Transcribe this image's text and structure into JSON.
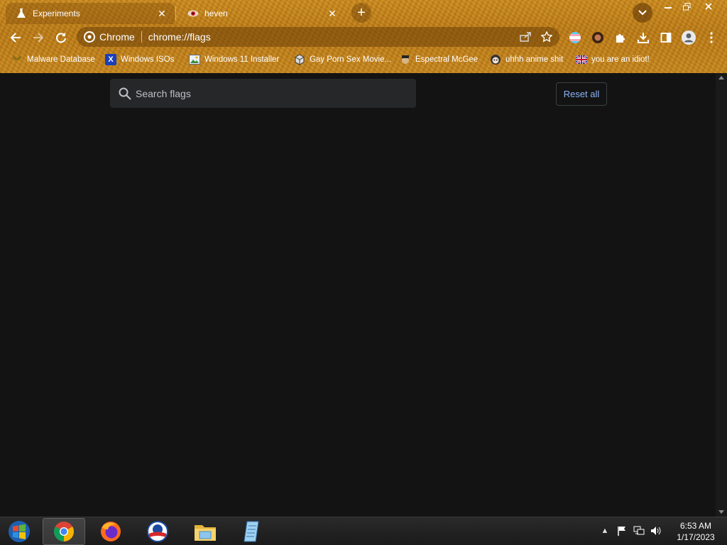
{
  "tabs": [
    {
      "title": "Experiments",
      "active": true,
      "icon": "flask-icon"
    },
    {
      "title": "heven",
      "active": false,
      "icon": "eye-icon"
    }
  ],
  "toolbar": {
    "chip_label": "Chrome",
    "url": "chrome://flags"
  },
  "bookmarks": [
    {
      "label": "Malware Database",
      "icon": "plant-icon"
    },
    {
      "label": "Windows ISOs",
      "icon": "x-logo-icon"
    },
    {
      "label": "Windows 11 Installer",
      "icon": "image-icon"
    },
    {
      "label": "Gay Porn Sex Movie...",
      "icon": "cube-icon"
    },
    {
      "label": "Espectral McGee",
      "icon": "avatar-icon"
    },
    {
      "label": "uhhh anime shit",
      "icon": "anime-icon"
    },
    {
      "label": "you are an idiot!",
      "icon": "flag-icon"
    }
  ],
  "page": {
    "search_placeholder": "Search flags",
    "reset_label": "Reset all"
  },
  "taskbar": {
    "apps": [
      "windows-start-icon",
      "chrome-icon",
      "firefox-icon",
      "obama-logo-icon",
      "file-explorer-icon",
      "notepad-icon"
    ],
    "time": "6:53 AM",
    "date": "1/17/2023"
  },
  "colors": {
    "page_bg": "#131313",
    "accent_link": "#8ab4f8",
    "theme_gold": "#c98a20"
  }
}
